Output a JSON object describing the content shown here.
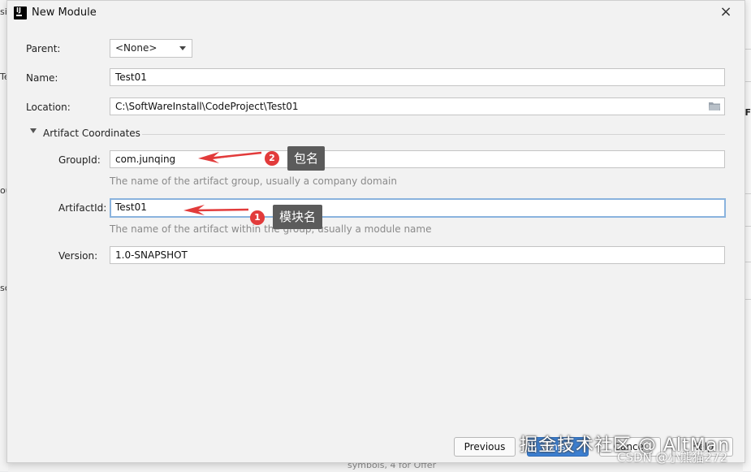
{
  "window": {
    "title": "New Module",
    "close_icon": "×"
  },
  "form": {
    "parent_label": "Parent:",
    "parent_value": "<None>",
    "name_label": "Name:",
    "name_value": "Test01",
    "location_label": "Location:",
    "location_value": "C:\\SoftWareInstall\\CodeProject\\Test01",
    "section_title": "Artifact Coordinates",
    "groupid_label": "GroupId:",
    "groupid_value": "com.junqing",
    "groupid_hint": "The name of the artifact group, usually a company domain",
    "artifactid_label": "ArtifactId:",
    "artifactid_value": "Test01",
    "artifactid_hint": "The name of the artifact within the group, usually a module name",
    "version_label": "Version:",
    "version_value": "1.0-SNAPSHOT"
  },
  "buttons": {
    "previous": "Previous",
    "finish": "Finish",
    "cancel": "Cancel",
    "help": "Help"
  },
  "annotations": {
    "badge1": "1",
    "callout1": "模块名",
    "badge2": "2",
    "callout2": "包名",
    "arrow_color": "#e23b3b"
  },
  "background": {
    "frag_a": "si",
    "frag_b": "Te",
    "frag_c": "ou",
    "frag_d": "sc",
    "frag_e": "eF",
    "bottom_text": "symbols, 4 for Offer"
  },
  "watermark": {
    "line1": "掘金技术社区 @ AltMan",
    "line2": "CSDN @小熊猫272"
  }
}
